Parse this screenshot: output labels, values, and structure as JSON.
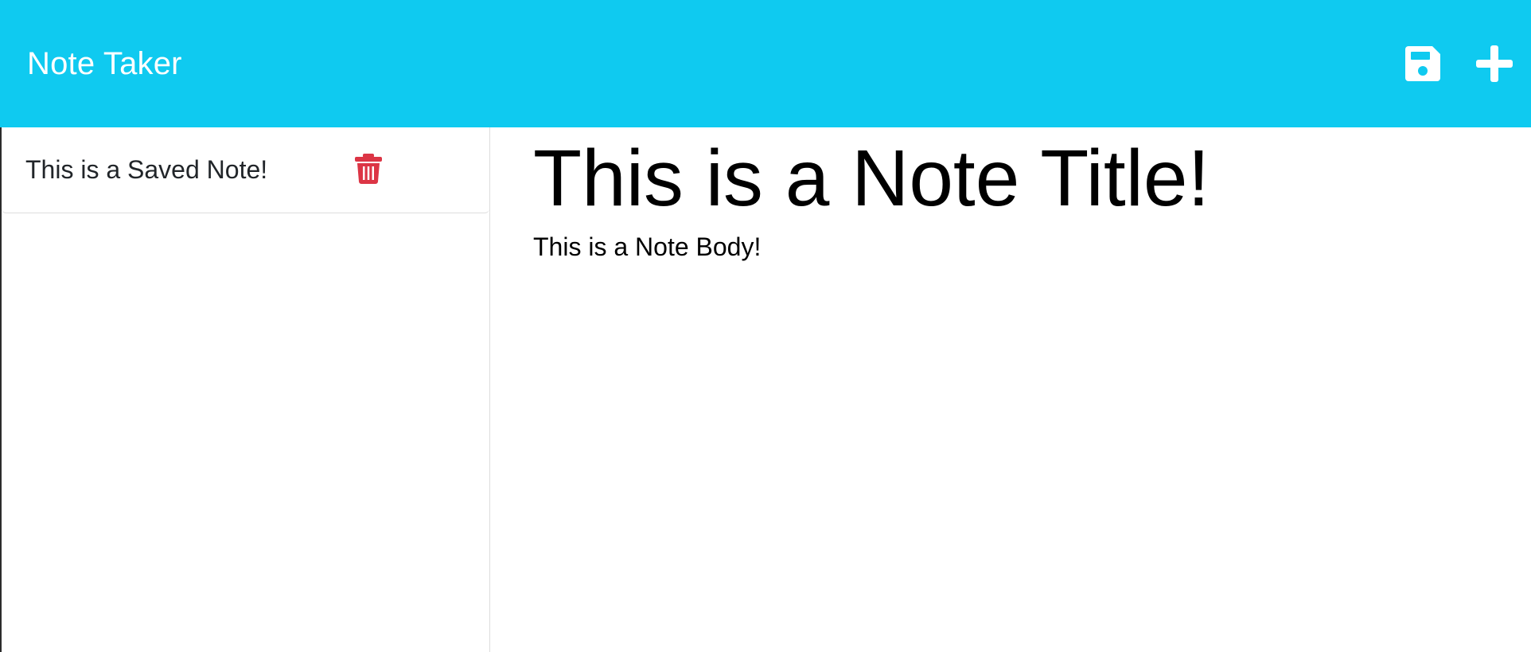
{
  "navbar": {
    "brand": "Note Taker",
    "save_icon": "save-icon",
    "new_note_icon": "plus-icon",
    "color": "#0fcaf0"
  },
  "sidebar": {
    "items": [
      {
        "title": "This is a Saved Note!",
        "delete_icon": "trash-icon",
        "delete_color": "#dc3545"
      }
    ]
  },
  "note": {
    "title": "This is a Note Title!",
    "body": "This is a Note Body!"
  }
}
